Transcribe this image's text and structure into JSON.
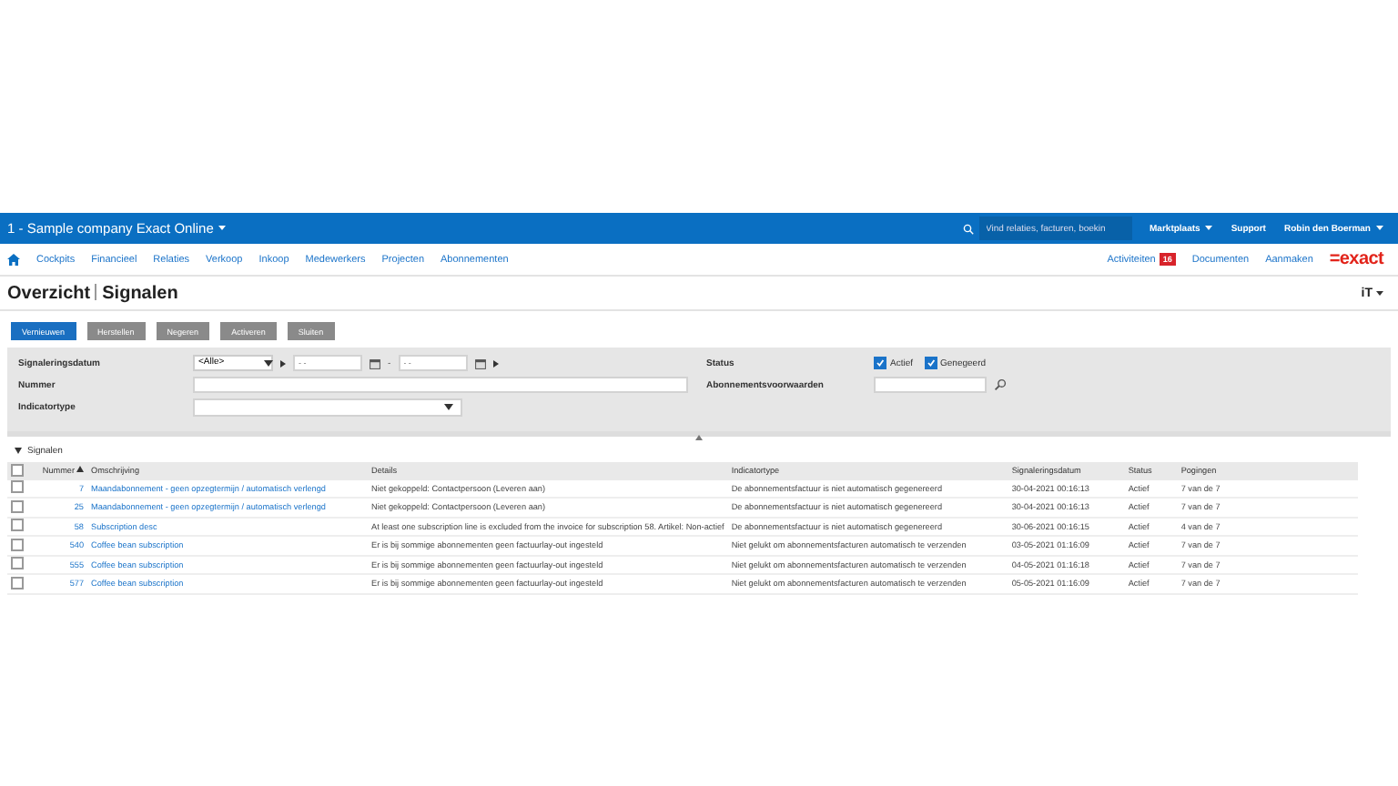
{
  "header": {
    "company": "1 - Sample company Exact Online",
    "search": {
      "placeholder": "Vind relaties, facturen, boekin"
    },
    "links": [
      "Marktplaats",
      "Support",
      "Robin den Boerman"
    ]
  },
  "nav": {
    "items": [
      "Cockpits",
      "Financieel",
      "Relaties",
      "Verkoop",
      "Inkoop",
      "Medewerkers",
      "Projecten",
      "Abonnementen"
    ],
    "right": [
      {
        "label": "Activiteiten",
        "badge": "16"
      },
      {
        "label": "Documenten"
      },
      {
        "label": "Aanmaken"
      }
    ],
    "logo": "=exact"
  },
  "page": {
    "title": "Overzicht",
    "subtitle": "Signalen",
    "menu": "iT"
  },
  "buttons": [
    {
      "label": "Vernieuwen",
      "primary": true
    },
    {
      "label": "Herstellen",
      "primary": false
    },
    {
      "label": "Negeren",
      "primary": false
    },
    {
      "label": "Activeren",
      "primary": false
    },
    {
      "label": "Sluiten",
      "primary": false
    }
  ],
  "filters": {
    "date": {
      "label": "Signaleringsdatum",
      "value": "<Alle>",
      "from": {
        "placeholder": "- -"
      },
      "separator": "-",
      "to": {
        "placeholder": "- -"
      }
    },
    "number": {
      "label": "Nummer"
    },
    "type": {
      "label": "Indicatortype"
    },
    "status": {
      "label": "Status",
      "options": [
        {
          "label": "Actief",
          "checked": true
        },
        {
          "label": "Genegeerd",
          "checked": true
        }
      ]
    },
    "terms": {
      "label": "Abonnementsvoorwaarden"
    }
  },
  "section": "Signalen",
  "table": {
    "all_checked": false,
    "columns": [
      "Nummer",
      "Omschrijving",
      "Details",
      "Indicatortype",
      "Signaleringsdatum",
      "Status",
      "Pogingen"
    ],
    "rows": [
      {
        "checked": false,
        "cells": [
          "7",
          "Maandabonnement - geen opzegtermijn / automatisch verlengd",
          "Niet gekoppeld: Contactpersoon (Leveren aan)",
          "De abonnementsfactuur is niet automatisch gegenereerd",
          "30-04-2021 00:16:13",
          "Actief",
          "7 van de 7"
        ]
      },
      {
        "checked": false,
        "cells": [
          "25",
          "Maandabonnement - geen opzegtermijn / automatisch verlengd",
          "Niet gekoppeld: Contactpersoon (Leveren aan)",
          "De abonnementsfactuur is niet automatisch gegenereerd",
          "30-04-2021 00:16:13",
          "Actief",
          "7 van de 7"
        ]
      },
      {
        "checked": false,
        "cells": [
          "58",
          "Subscription desc",
          "At least one subscription line is excluded from the invoice for subscription 58. Artikel: Non-actief",
          "De abonnementsfactuur is niet automatisch gegenereerd",
          "30-06-2021 00:16:15",
          "Actief",
          "4 van de 7"
        ]
      },
      {
        "checked": false,
        "cells": [
          "540",
          "Coffee bean subscription",
          "Er is bij sommige abonnementen geen factuurlay-out ingesteld",
          "Niet gelukt om abonnementsfacturen automatisch te verzenden",
          "03-05-2021 01:16:09",
          "Actief",
          "7 van de 7"
        ]
      },
      {
        "checked": false,
        "cells": [
          "555",
          "Coffee bean subscription",
          "Er is bij sommige abonnementen geen factuurlay-out ingesteld",
          "Niet gelukt om abonnementsfacturen automatisch te verzenden",
          "04-05-2021 01:16:18",
          "Actief",
          "7 van de 7"
        ]
      },
      {
        "checked": false,
        "cells": [
          "577",
          "Coffee bean subscription",
          "Er is bij sommige abonnementen geen factuurlay-out ingesteld",
          "Niet gelukt om abonnementsfacturen automatisch te verzenden",
          "05-05-2021 01:16:09",
          "Actief",
          "7 van de 7"
        ]
      }
    ]
  }
}
